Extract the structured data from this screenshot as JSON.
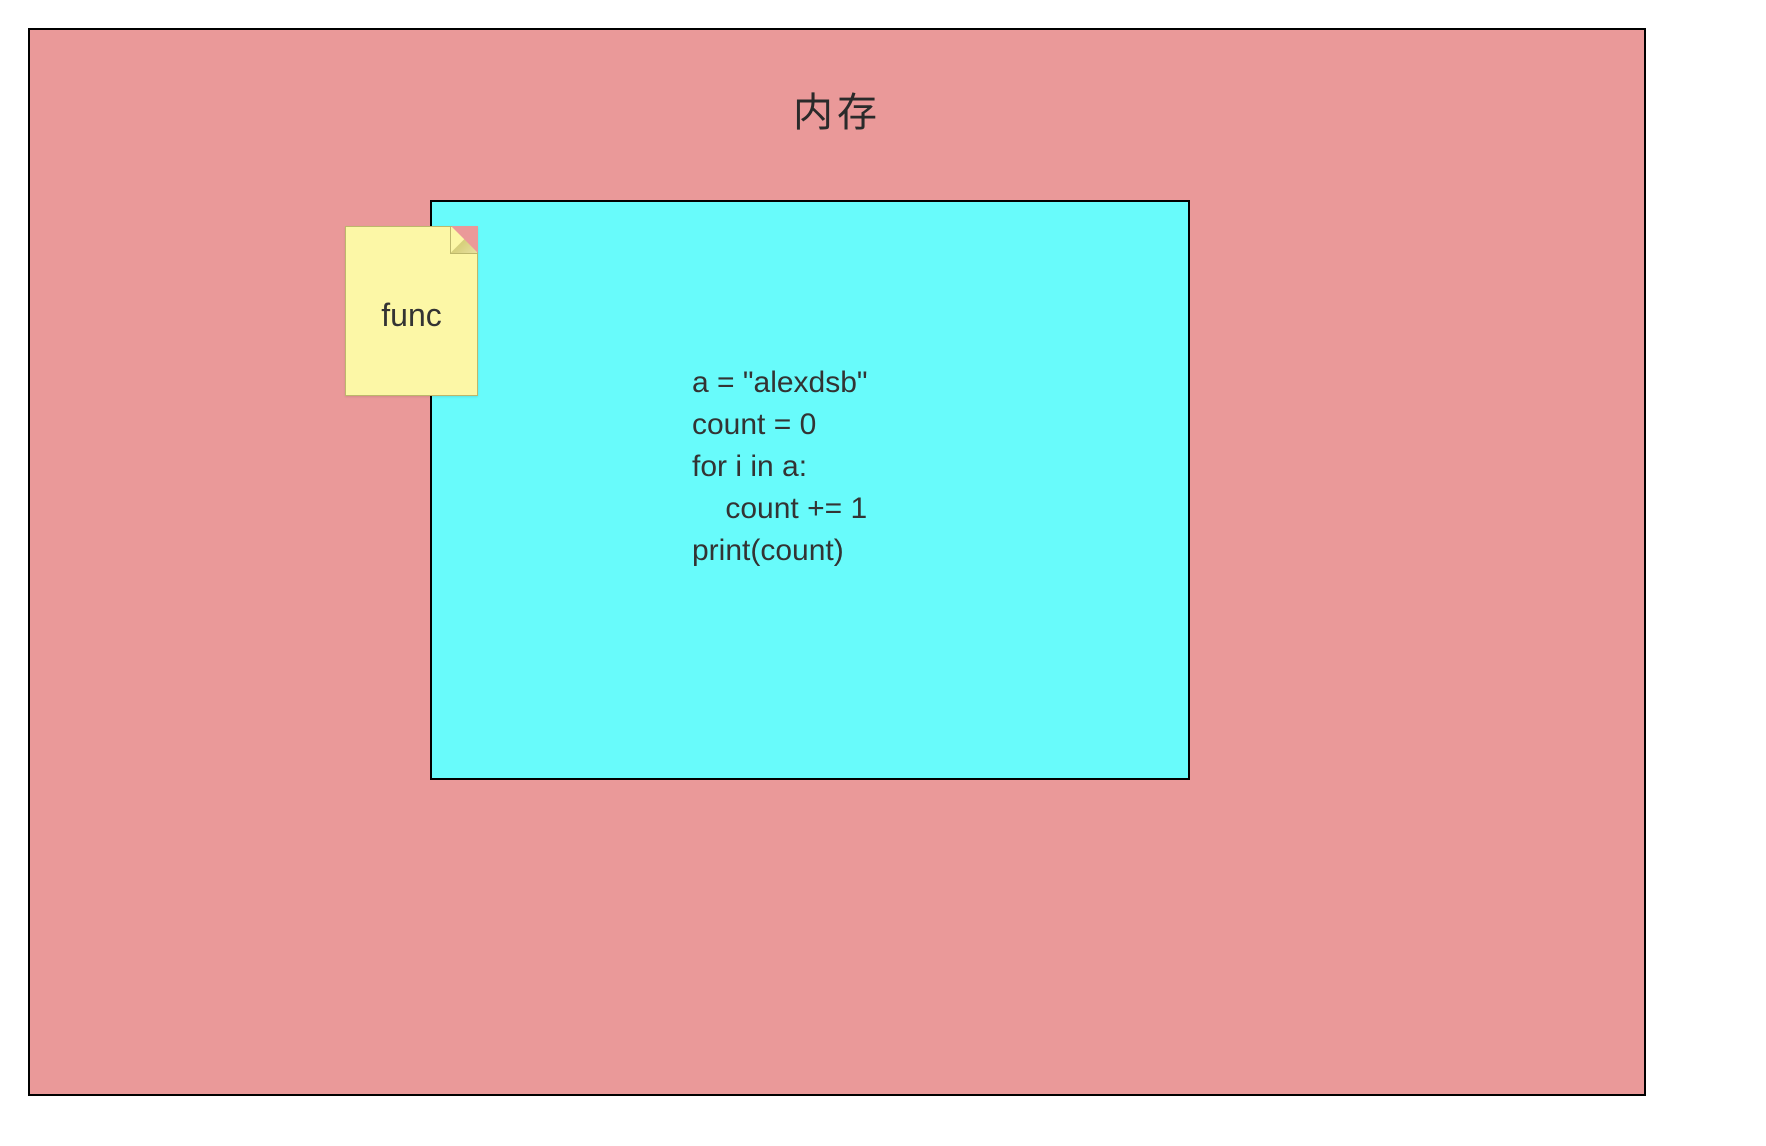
{
  "memory": {
    "title": "内存"
  },
  "file": {
    "label": "func"
  },
  "code": {
    "line1": "a = \"alexdsb\"",
    "line2": "count = 0",
    "line3": "for i in a:",
    "line4": "    count += 1",
    "line5": "print(count)"
  }
}
